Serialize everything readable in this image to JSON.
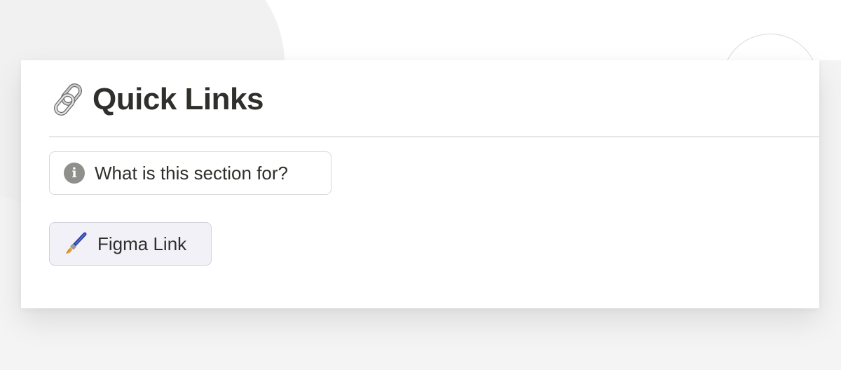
{
  "section": {
    "icon": "chain-link-icon",
    "title": "Quick Links"
  },
  "buttons": {
    "info": {
      "icon": "info-icon",
      "label": "What is this section for?"
    },
    "figma": {
      "icon": "paintbrush-icon",
      "label": "Figma Link"
    }
  },
  "colors": {
    "text": "#2f2f2b",
    "figma_button_bg": "#f3f1f8",
    "info_icon": "#8f8f8b",
    "border": "#d9d9d9"
  }
}
